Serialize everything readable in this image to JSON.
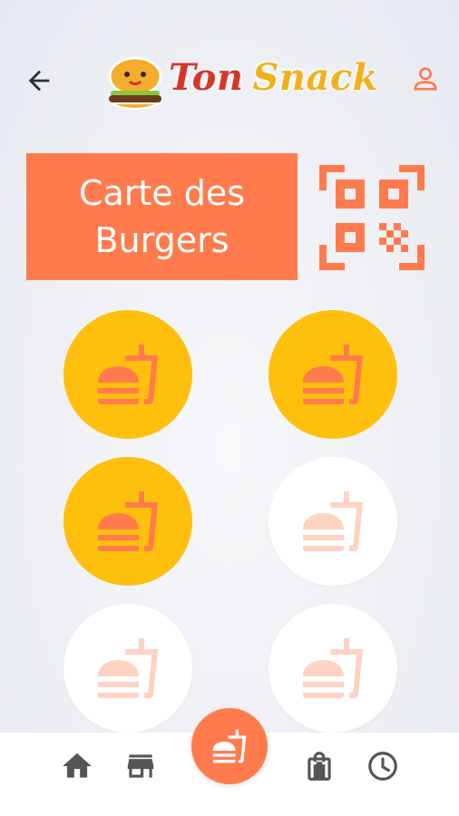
{
  "header": {
    "back_icon": "arrow-left-icon",
    "profile_icon": "user-icon",
    "logo": {
      "word1": "Ton",
      "word2": "Snack"
    }
  },
  "title": {
    "line1": "Carte des",
    "line2": "Burgers"
  },
  "qr_icon": "qr-code-icon",
  "stamp_card": {
    "total_slots": 6,
    "stamps_collected": 3,
    "slot_icon": "burger-drink-icon"
  },
  "bottom_nav": {
    "items": [
      "home-icon",
      "store-icon",
      "burger-drink-icon",
      "shopping-bag-icon",
      "clock-icon"
    ],
    "active": "burger-drink-icon"
  },
  "colors": {
    "accent": "#ff7b4d",
    "stamp_filled": "#ffbf0d",
    "stamp_empty": "#ffffff",
    "stamp_icon_filled": "#ff7b4d",
    "stamp_icon_empty": "#ffd2c2",
    "nav_icon": "#555555"
  }
}
